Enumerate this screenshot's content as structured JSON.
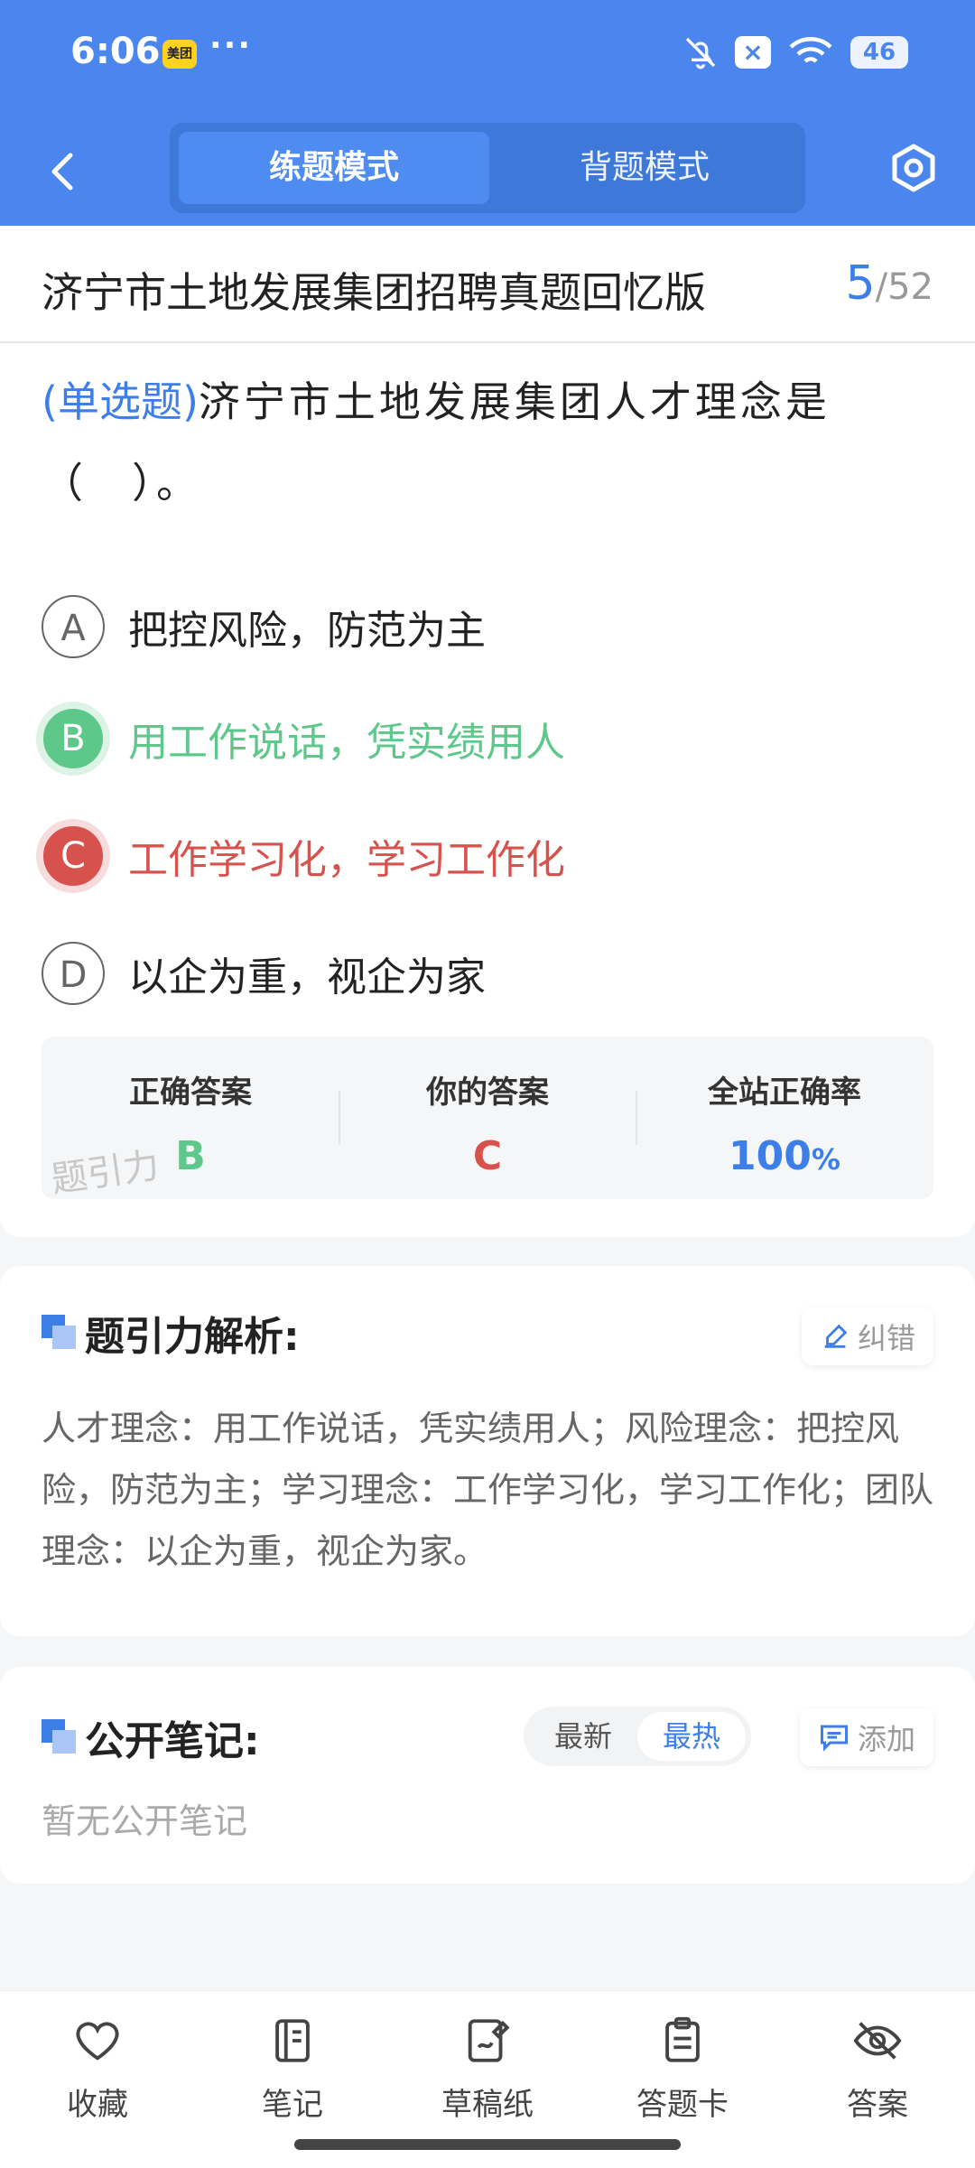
{
  "status_bar": {
    "time": "6:06",
    "app_badge": "美团",
    "dots": "···",
    "battery": "46"
  },
  "nav": {
    "mode_practice": "练题模式",
    "mode_recite": "背题模式"
  },
  "paper": {
    "title": "济宁市土地发展集团招聘真题回忆版",
    "current": "5",
    "separator": "/",
    "total": "52"
  },
  "question": {
    "type": "(单选题)",
    "text": "济宁市土地发展集团人才理念是（　）。",
    "options": [
      {
        "letter": "A",
        "text": "把控风险，防范为主",
        "state": "normal"
      },
      {
        "letter": "B",
        "text": "用工作说话，凭实绩用人",
        "state": "correct"
      },
      {
        "letter": "C",
        "text": "工作学习化，学习工作化",
        "state": "wrong"
      },
      {
        "letter": "D",
        "text": "以企为重，视企为家",
        "state": "normal"
      }
    ]
  },
  "answers": {
    "correct_label": "正确答案",
    "correct_value": "B",
    "yours_label": "你的答案",
    "yours_value": "C",
    "rate_label": "全站正确率",
    "rate_value": "100",
    "rate_unit": "%",
    "watermark": "题引力"
  },
  "analysis": {
    "title": "题引力解析:",
    "report_label": "纠错",
    "text": "人才理念：用工作说话，凭实绩用人；风险理念：把控风险，防范为主；学习理念：工作学习化，学习工作化；团队理念：以企为重，视企为家。"
  },
  "notes": {
    "title": "公开笔记:",
    "sort_newest": "最新",
    "sort_hottest": "最热",
    "add_label": "添加",
    "empty_text": "暂无公开笔记"
  },
  "bottom_bar": {
    "items": [
      {
        "label": "收藏",
        "icon": "heart-icon"
      },
      {
        "label": "笔记",
        "icon": "notebook-icon"
      },
      {
        "label": "草稿纸",
        "icon": "draft-icon"
      },
      {
        "label": "答题卡",
        "icon": "clipboard-icon"
      },
      {
        "label": "答案",
        "icon": "eye-off-icon"
      }
    ]
  },
  "colors": {
    "accent": "#4a86ee",
    "correct": "#5ec88b",
    "wrong": "#d7524d"
  }
}
